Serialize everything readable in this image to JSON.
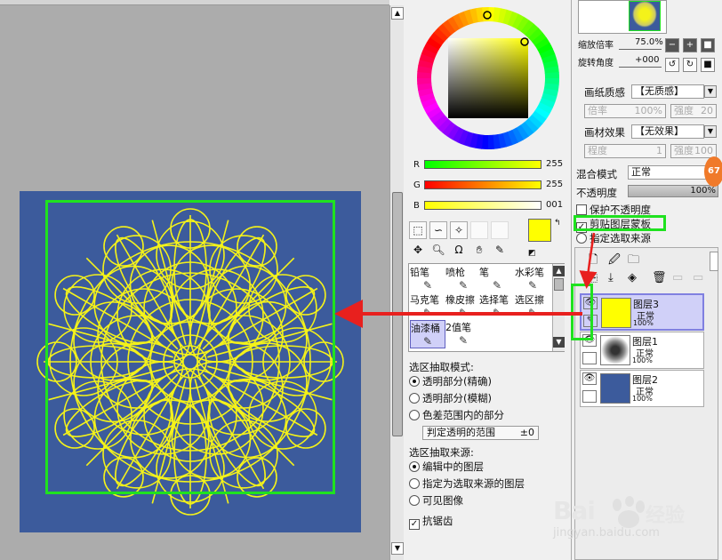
{
  "colors": {
    "canvas_bg": "#acacac",
    "artwork_bg": "#3c5b9c",
    "artwork_line": "#f4f21a",
    "highlight_green": "#1fe21f",
    "arrow_red": "#e8201e",
    "selected_layer": "#d0d0f8",
    "current_color": "#ffff00"
  },
  "color_panel": {
    "sliders": [
      {
        "label": "R",
        "value": "255"
      },
      {
        "label": "G",
        "value": "255"
      },
      {
        "label": "B",
        "value": "001"
      }
    ],
    "brushes": [
      {
        "label": "铅笔",
        "icon": "pencil-icon"
      },
      {
        "label": "喷枪",
        "icon": "airbrush-icon"
      },
      {
        "label": "笔",
        "icon": "pen-icon"
      },
      {
        "label": "水彩笔",
        "icon": "watercolor-icon"
      },
      {
        "label": "马克笔",
        "icon": "marker-icon"
      },
      {
        "label": "橡皮擦",
        "icon": "eraser-icon"
      },
      {
        "label": "选择笔",
        "icon": "select-pen-icon"
      },
      {
        "label": "选区擦",
        "icon": "select-eraser-icon"
      },
      {
        "label": "油漆桶",
        "icon": "bucket-icon"
      },
      {
        "label": "2值笔",
        "icon": "binary-pen-icon"
      }
    ],
    "selection_mode": {
      "heading": "选区抽取模式:",
      "options": [
        "透明部分(精确)",
        "透明部分(模糊)",
        "色差范围内的部分"
      ],
      "selected_index": 0,
      "range_label": "判定透明的范围",
      "range_value": "±0"
    },
    "selection_source": {
      "heading": "选区抽取来源:",
      "options": [
        "编辑中的图层",
        "指定为选取来源的图层",
        "可见图像"
      ],
      "selected_index": 0
    },
    "antialias_label": "抗锯齿"
  },
  "right_panel": {
    "zoom_label": "缩放倍率",
    "zoom_value": "75.0%",
    "rotation_label": "旋转角度",
    "rotation_value": "+000",
    "paper_texture_label": "画纸质感",
    "paper_texture_value": "【无质感】",
    "paper_scale_label": "倍率",
    "paper_scale_value": "100%",
    "paper_strength_label": "强度",
    "paper_strength_value": "20",
    "material_effect_label": "画材效果",
    "material_effect_value": "【无效果】",
    "material_degree_label": "程度",
    "material_degree_value": "1",
    "material_strength_label": "强度",
    "material_strength_value": "100",
    "blend_mode_label": "混合模式",
    "blend_mode_value": "正常",
    "opacity_label": "不透明度",
    "opacity_value": "100%",
    "protect_opacity_label": "保护不透明度",
    "clipping_mask_label": "剪贴图层蒙板",
    "selection_source_label": "指定选取来源",
    "badge": "67",
    "layers": [
      {
        "name": "图层3",
        "mode": "正常",
        "opacity": "100%"
      },
      {
        "name": "图层1",
        "mode": "正常",
        "opacity": "100%"
      },
      {
        "name": "图层2",
        "mode": "正常",
        "opacity": "100%"
      }
    ]
  },
  "watermark": {
    "brand": "Bai",
    "brand_cn": "经验",
    "url": "jingyan.baidu.com"
  }
}
